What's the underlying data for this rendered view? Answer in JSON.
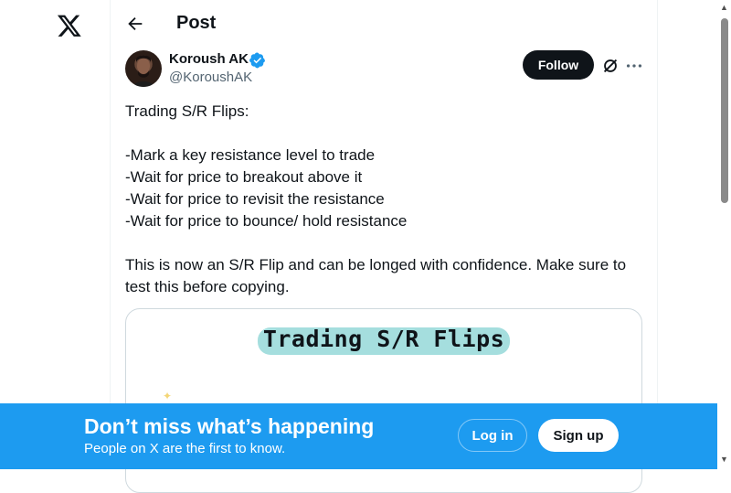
{
  "app": {
    "logo_icon": "x-logo-icon"
  },
  "header": {
    "title": "Post",
    "back_icon": "arrow-left-icon"
  },
  "post": {
    "author_name": "Koroush AK",
    "author_handle": "@KoroushAK",
    "verified_icon": "verified-badge-icon",
    "follow_label": "Follow",
    "grok_icon": "grok-icon",
    "more_icon": "more-horizontal-icon",
    "text": {
      "line1": "Trading S/R Flips:",
      "line2": "-Mark a key resistance level to trade",
      "line3": "-Wait for price to breakout above it",
      "line4": "-Wait for price to revisit the resistance",
      "line5": "-Wait for price to bounce/ hold resistance",
      "line6": "This is now an S/R Flip and can be longed with confidence. Make sure to test this before copying."
    },
    "media": {
      "title": "Trading S/R Flips"
    }
  },
  "banner": {
    "title": "Don’t miss what’s happening",
    "subtitle": "People on X are the first to know.",
    "login_label": "Log in",
    "signup_label": "Sign up"
  },
  "colors": {
    "accent": "#1d9bf0",
    "text": "#0f1419",
    "muted": "#536471"
  }
}
